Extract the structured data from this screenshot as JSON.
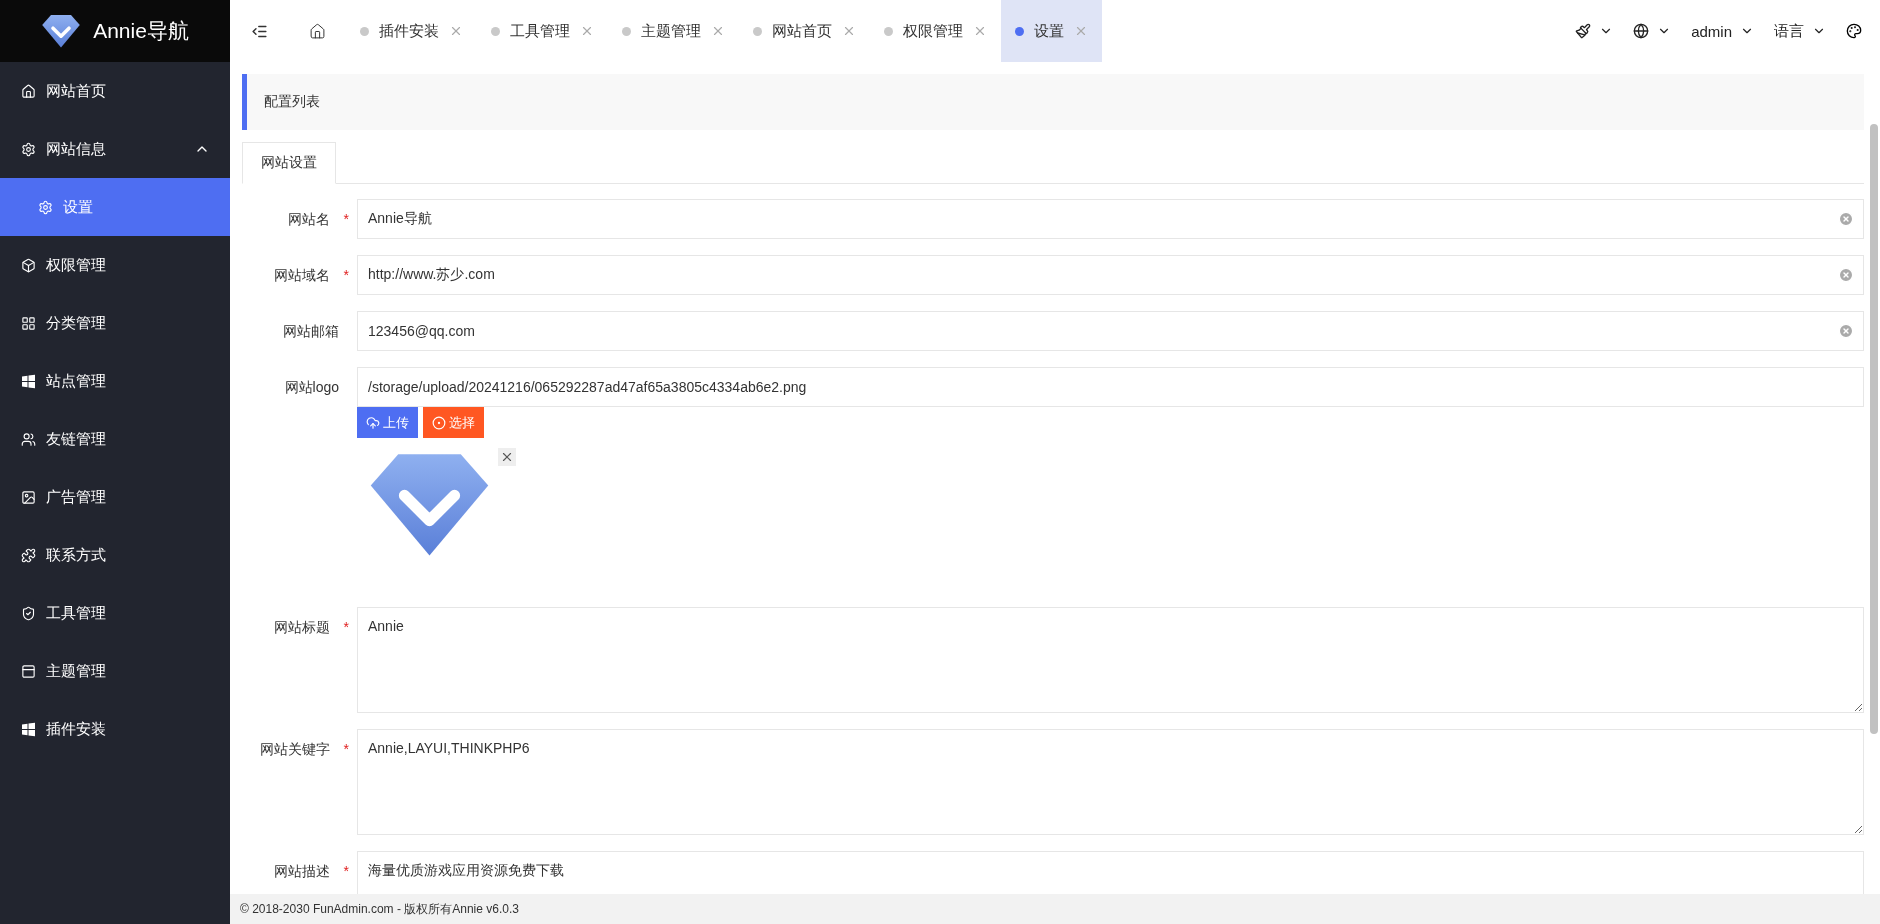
{
  "brand": {
    "name": "Annie导航"
  },
  "sidebar": {
    "items": [
      {
        "label": "网站首页",
        "selected": false
      },
      {
        "label": "网站信息",
        "selected": false,
        "expanded": true,
        "children": [
          {
            "label": "设置",
            "selected": true
          }
        ]
      },
      {
        "label": "权限管理",
        "selected": false
      },
      {
        "label": "分类管理",
        "selected": false
      },
      {
        "label": "站点管理",
        "selected": false
      },
      {
        "label": "友链管理",
        "selected": false
      },
      {
        "label": "广告管理",
        "selected": false
      },
      {
        "label": "联系方式",
        "selected": false
      },
      {
        "label": "工具管理",
        "selected": false
      },
      {
        "label": "主题管理",
        "selected": false
      },
      {
        "label": "插件安装",
        "selected": false
      }
    ]
  },
  "tabs": [
    {
      "label": "插件安装",
      "selected": false
    },
    {
      "label": "工具管理",
      "selected": false
    },
    {
      "label": "主题管理",
      "selected": false
    },
    {
      "label": "网站首页",
      "selected": false
    },
    {
      "label": "权限管理",
      "selected": false
    },
    {
      "label": "设置",
      "selected": true
    }
  ],
  "header_tools": [
    {
      "kind": "brush"
    },
    {
      "kind": "globe"
    },
    {
      "kind": "text",
      "label": "admin"
    },
    {
      "kind": "text",
      "label": "语言"
    },
    {
      "kind": "palette"
    }
  ],
  "breadcrumb": "配置列表",
  "form_tabs": [
    {
      "label": "网站设置",
      "selected": true
    }
  ],
  "fields": [
    {
      "kind": "input",
      "label": "网站名",
      "required_mark": "*",
      "value": "Annie导航",
      "clearable": true
    },
    {
      "kind": "input",
      "label": "网站域名",
      "required_mark": "*",
      "value": "http://www.苏少.com",
      "clearable": true
    },
    {
      "kind": "input",
      "label": "网站邮箱",
      "value": "123456@qq.com",
      "clearable": true
    },
    {
      "kind": "upload",
      "label": "网站logo",
      "value": "/storage/upload/20241216/065292287ad47af65a3805c4334ab6e2.png",
      "buttons": [
        {
          "label": "上传",
          "kind": "upload"
        },
        {
          "label": "选择",
          "kind": "select"
        }
      ]
    },
    {
      "kind": "textarea",
      "label": "网站标题",
      "required_mark": "*",
      "value": "Annie"
    },
    {
      "kind": "textarea",
      "label": "网站关键字",
      "required_mark": "*",
      "value": "Annie,LAYUI,THINKPHP6"
    },
    {
      "kind": "textarea",
      "label": "网站描述",
      "required_mark": "*",
      "value": "海量优质游戏应用资源免费下载"
    }
  ],
  "footer": "© 2018-2030 FunAdmin.com - 版权所有Annie v6.0.3"
}
